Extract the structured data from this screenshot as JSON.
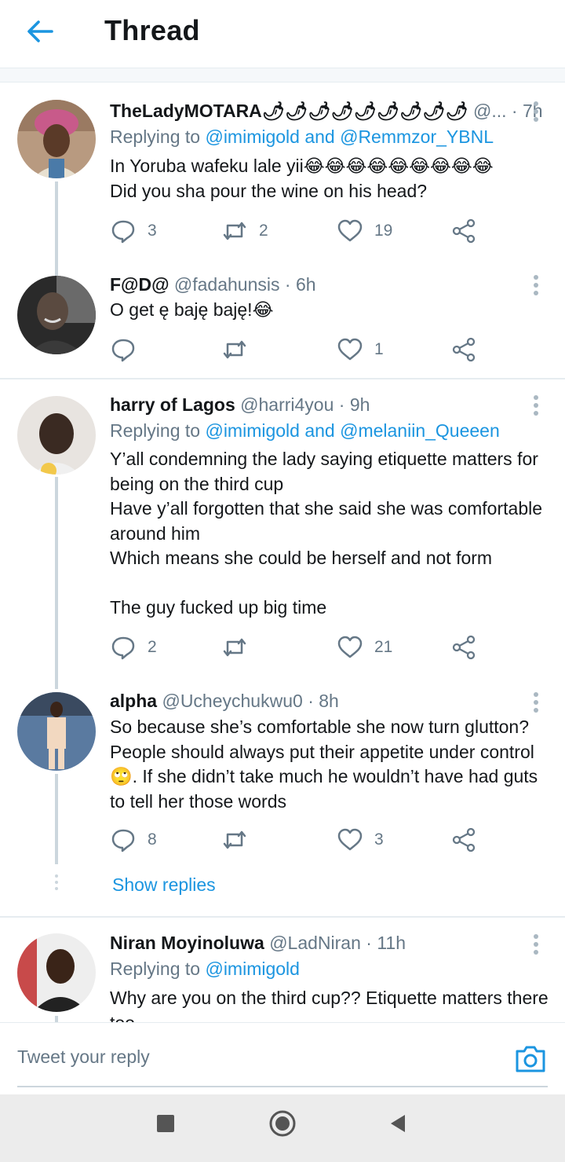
{
  "header": {
    "title": "Thread",
    "back_icon": "arrow-left-icon"
  },
  "tweets": [
    {
      "name": "TheLadyMOTARA🌶🌶🌶🌶🌶🌶🌶🌶🌶",
      "handle": "@...",
      "time": "· 7h",
      "replying_prefix": "Replying to",
      "replying_to": "@imimigold and @Remmzor_YBNL",
      "text": "In Yoruba wafeku lale yii😂😂😂😂😂😂😂😂😂\nDid you sha pour the wine on his head?",
      "replies": "3",
      "retweets": "2",
      "likes": "19"
    },
    {
      "name": "F@D@",
      "handle": "@fadahunsis",
      "time": "· 6h",
      "text": "O get ę baję baję!😂",
      "replies": "",
      "retweets": "",
      "likes": "1"
    },
    {
      "name": "harry of Lagos",
      "handle": "@harri4you",
      "time": "· 9h",
      "replying_prefix": "Replying to",
      "replying_to": "@imimigold and @melaniin_Queeen",
      "text": "Y’all condemning the lady saying etiquette matters for being on the third cup\nHave y’all forgotten that she said she was comfortable around him\nWhich means she could be herself and not form\n\nThe guy fucked up big time",
      "replies": "2",
      "retweets": "",
      "likes": "21"
    },
    {
      "name": "alpha",
      "handle": "@Ucheychukwu0",
      "time": "· 8h",
      "text": "So because she’s comfortable she now turn glutton? People should always put their appetite under control 🙄. If she didn’t take much he wouldn’t have had guts to tell her those words",
      "replies": "8",
      "retweets": "",
      "likes": "3",
      "show_replies": "Show replies"
    },
    {
      "name": "Niran Moyinoluwa",
      "handle": "@LadNiran",
      "time": "· 11h",
      "replying_prefix": "Replying to",
      "replying_to": "@imimigold",
      "text": "Why are you on the third cup?? Etiquette matters there too"
    }
  ],
  "compose": {
    "placeholder": "Tweet your reply",
    "camera_icon": "camera-icon"
  },
  "navbar": {
    "recents_icon": "square-icon",
    "home_icon": "circle-icon",
    "back_icon": "triangle-back-icon"
  },
  "colors": {
    "accent": "#1b95e0",
    "text": "#14171a",
    "muted": "#657786",
    "divider": "#e6ecf0"
  }
}
